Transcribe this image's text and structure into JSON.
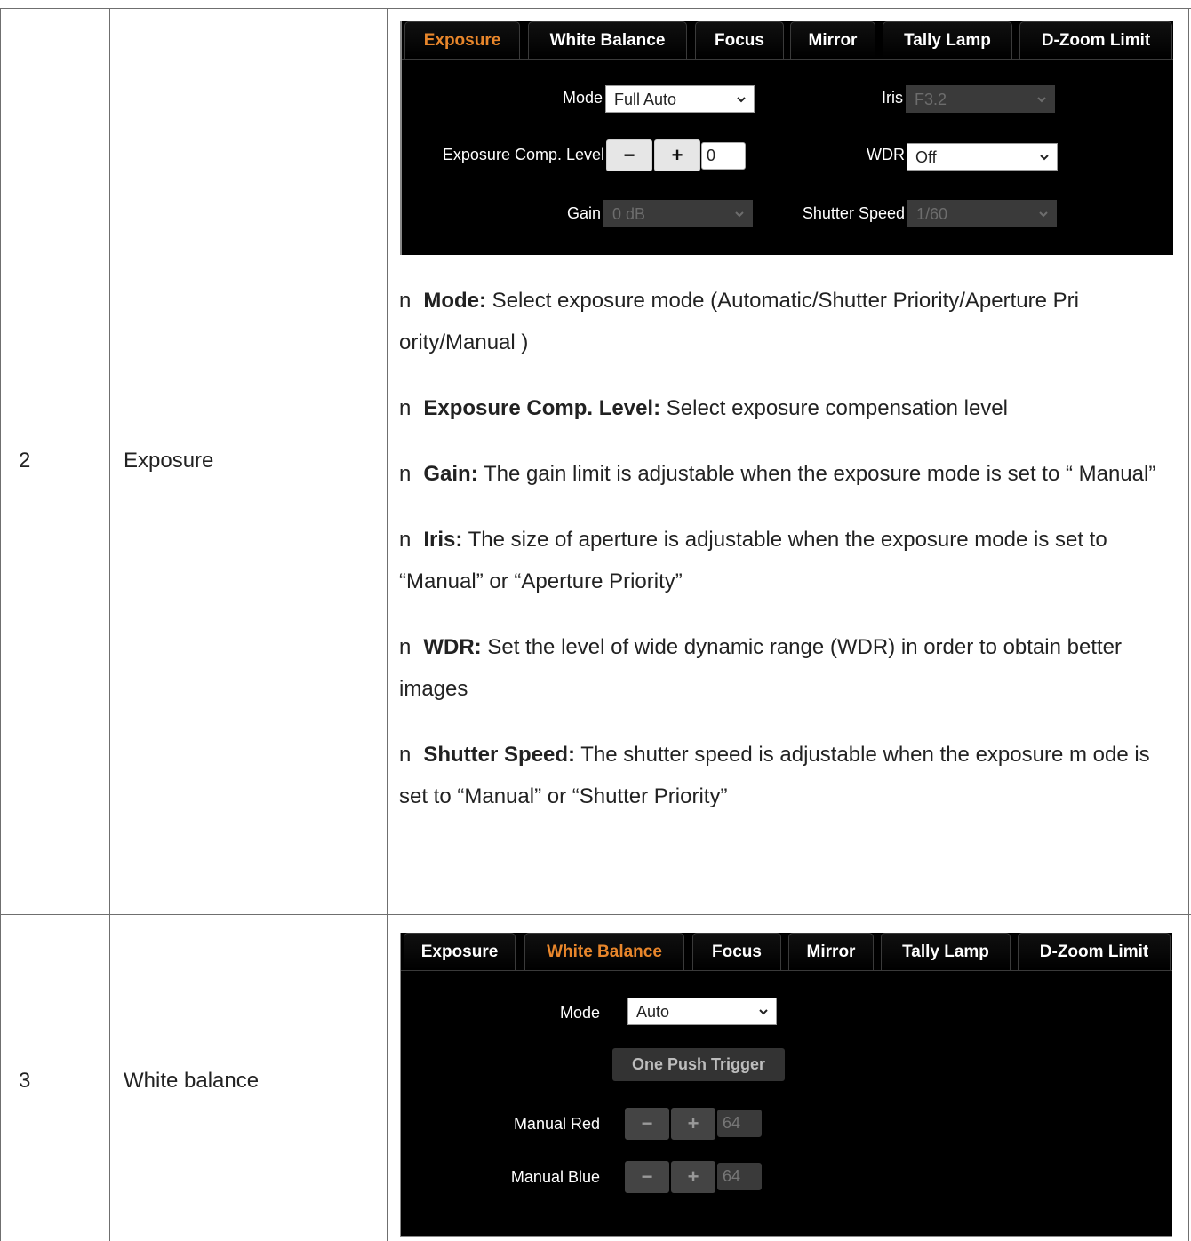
{
  "rows": [
    {
      "number": "2",
      "item": "Exposure"
    },
    {
      "number": "3",
      "item": "White balance"
    }
  ],
  "tabs": [
    "Exposure",
    "White Balance",
    "Focus",
    "Mirror",
    "Tally Lamp",
    "D-Zoom Limit"
  ],
  "exposure_panel": {
    "mode_label": "Mode",
    "mode_value": "Full Auto",
    "iris_label": "Iris",
    "iris_value": "F3.2",
    "comp_label": "Exposure Comp. Level",
    "comp_value": "0",
    "wdr_label": "WDR",
    "wdr_value": "Off",
    "gain_label": "Gain",
    "gain_value": "0 dB",
    "shutter_label": "Shutter Speed",
    "shutter_value": "1/60",
    "minus": "−",
    "plus": "+"
  },
  "descriptions": [
    {
      "bullet": "n",
      "term": "Mode:",
      "text": " Select exposure mode (Automatic/Shutter Priority/Aperture Pri ority/Manual )"
    },
    {
      "bullet": "n",
      "term": "Exposure Comp. Level:",
      "text": " Select exposure compensation level"
    },
    {
      "bullet": "n",
      "term": "Gain:",
      "text": " The gain limit is adjustable when the exposure mode is set to “ Manual”"
    },
    {
      "bullet": "n",
      "term": "Iris:",
      "text": " The size of aperture is adjustable when the exposure mode is set to “Manual” or “Aperture Priority”"
    },
    {
      "bullet": "n",
      "term": "WDR:",
      "text": " Set the level of wide dynamic range (WDR) in order to obtain better images"
    },
    {
      "bullet": "n",
      "term": "Shutter Speed:",
      "text": " The shutter speed is adjustable when the exposure m ode is set to “Manual” or “Shutter Priority”"
    }
  ],
  "wb_panel": {
    "mode_label": "Mode",
    "mode_value": "Auto",
    "one_push": "One Push Trigger",
    "red_label": "Manual Red",
    "red_value": "64",
    "blue_label": "Manual Blue",
    "blue_value": "64",
    "minus": "−",
    "plus": "+"
  }
}
